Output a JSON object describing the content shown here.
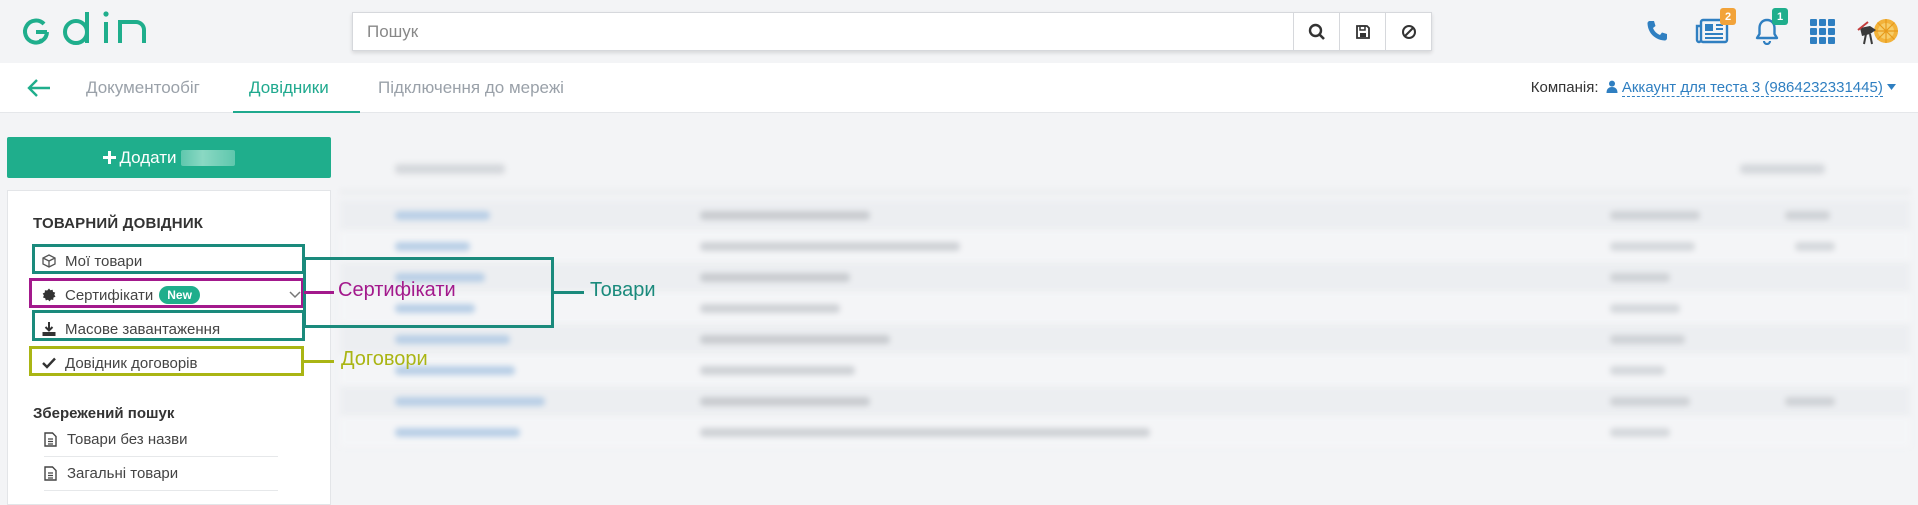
{
  "search": {
    "placeholder": "Пошук"
  },
  "badges": {
    "news": "2",
    "notifications": "1"
  },
  "tabs": [
    {
      "label": "Документообіг"
    },
    {
      "label": "Довідники"
    },
    {
      "label": "Підключення до мережі"
    }
  ],
  "company": {
    "label": "Компанія:",
    "account": "Аккаунт для теста 3 (9864232331445)"
  },
  "sidebar": {
    "add_label": "Додати",
    "section_title": "ТОВАРНИЙ ДОВІДНИК",
    "items": [
      {
        "label": "Мої товари"
      },
      {
        "label": "Сертифікати",
        "badge": "New"
      },
      {
        "label": "Масове завантаження"
      },
      {
        "label": "Довідник договорів"
      }
    ],
    "saved_title": "Збережений пошук",
    "saved_items": [
      {
        "label": "Товари без назви"
      },
      {
        "label": "Загальні товари"
      }
    ]
  },
  "annotations": {
    "certificates": "Сертифікати",
    "goods": "Товари",
    "contracts": "Договори"
  },
  "colors": {
    "brand": "#1fae8c",
    "link": "#2f7fc1",
    "annot_teal": "#1a8a7c",
    "annot_magenta": "#a3198c",
    "annot_olive": "#aab514",
    "badge_orange": "#f2a33a",
    "badge_green": "#1fae8c"
  }
}
